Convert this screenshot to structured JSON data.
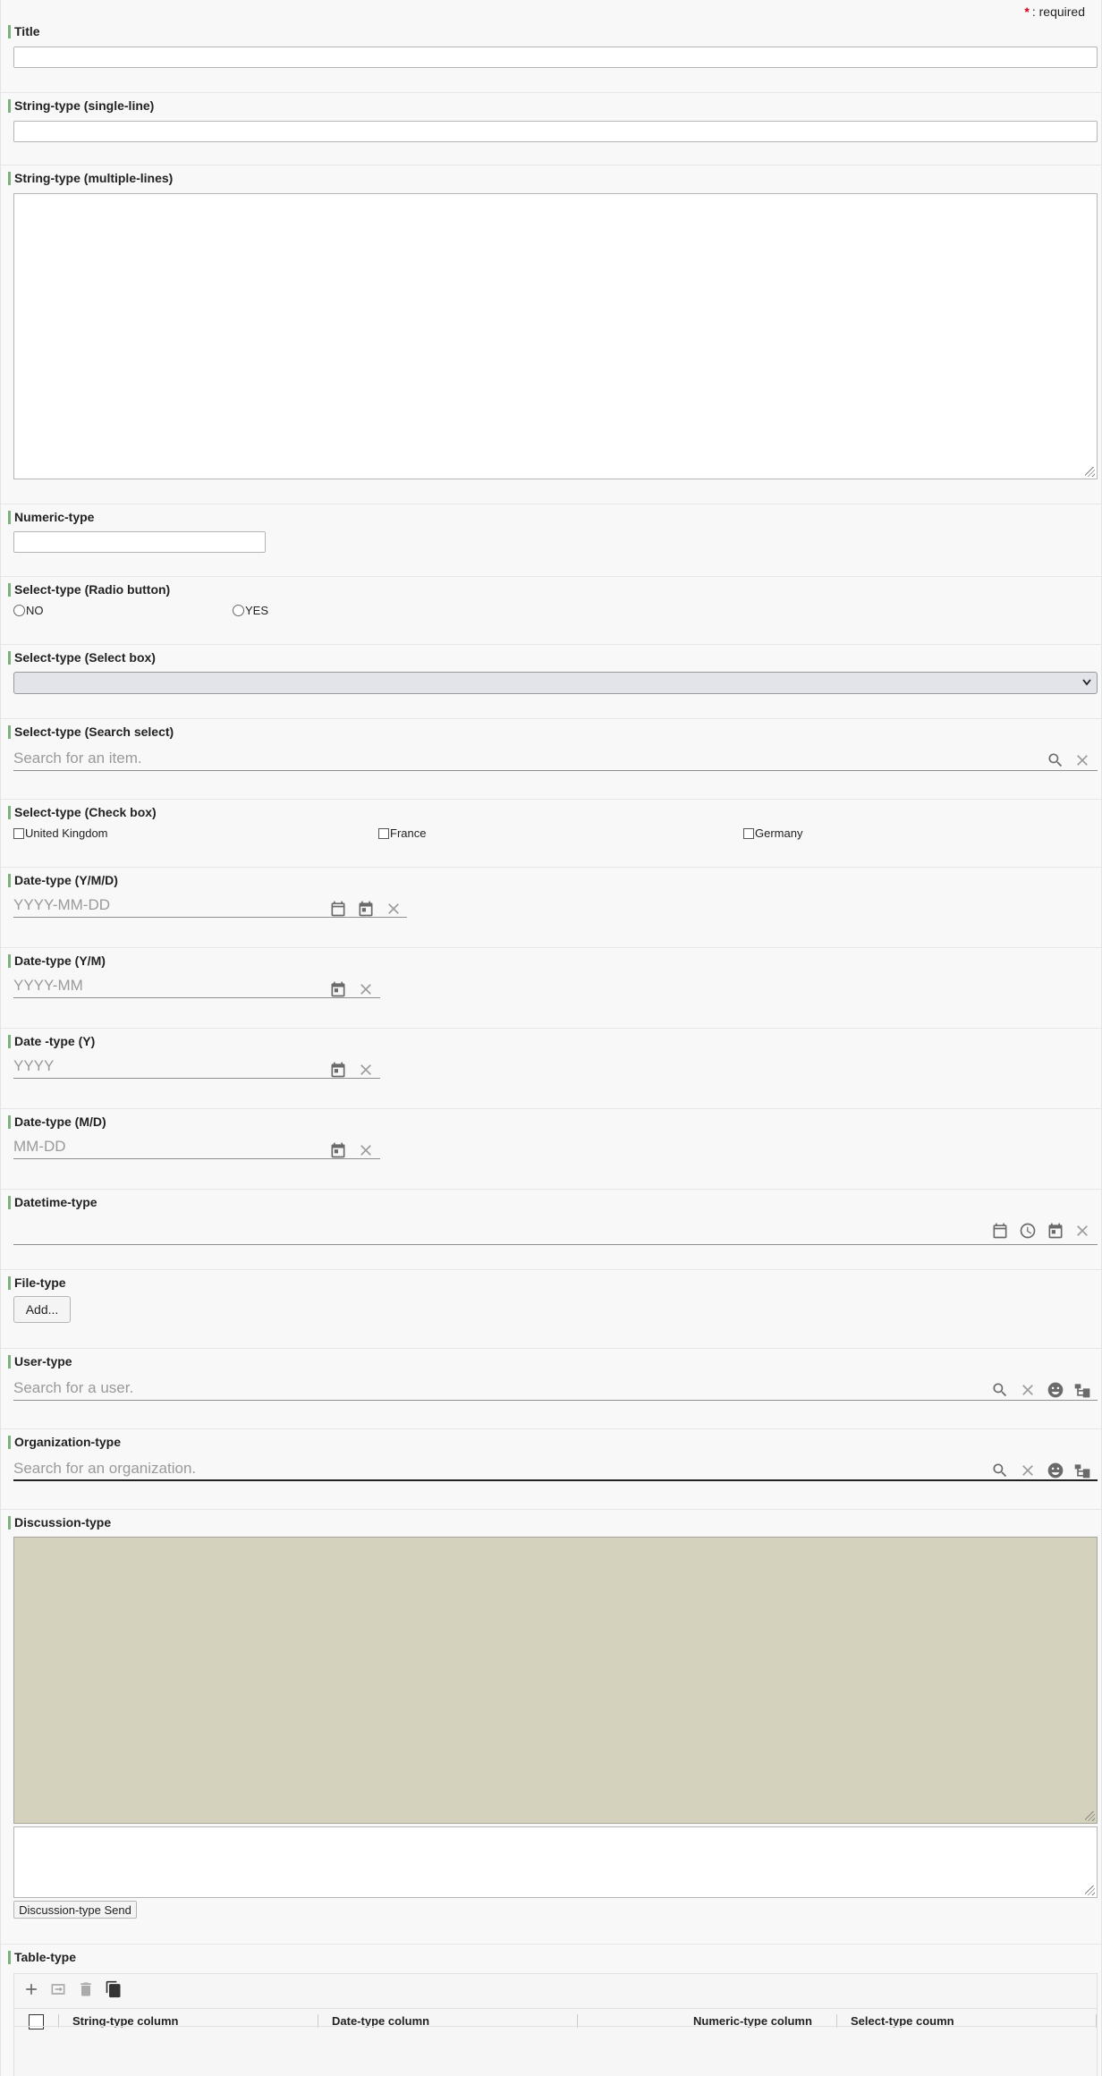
{
  "required_note": {
    "star": "*",
    "text": ": required"
  },
  "fields": {
    "title": {
      "label": "Title"
    },
    "string_single": {
      "label": "String-type (single-line)"
    },
    "string_multi": {
      "label": "String-type (multiple-lines)"
    },
    "numeric": {
      "label": "Numeric-type"
    },
    "radio": {
      "label": "Select-type (Radio button)",
      "options": [
        "NO",
        "YES"
      ]
    },
    "selectbox": {
      "label": "Select-type (Select box)"
    },
    "search_select": {
      "label": "Select-type (Search select)",
      "placeholder": "Search for an item."
    },
    "checkbox": {
      "label": "Select-type (Check box)",
      "options": [
        "United Kingdom",
        "France",
        "Germany"
      ]
    },
    "date_ymd": {
      "label": "Date-type (Y/M/D)",
      "placeholder": "YYYY-MM-DD"
    },
    "date_ym": {
      "label": "Date-type (Y/M)",
      "placeholder": "YYYY-MM"
    },
    "date_y": {
      "label": "Date -type (Y)",
      "placeholder": "YYYY"
    },
    "date_md": {
      "label": "Date-type (M/D)",
      "placeholder": "MM-DD"
    },
    "datetime": {
      "label": "Datetime-type"
    },
    "file": {
      "label": "File-type",
      "button": "Add..."
    },
    "user": {
      "label": "User-type",
      "placeholder": "Search for a user."
    },
    "org": {
      "label": "Organization-type",
      "placeholder": "Search for an organization."
    },
    "discussion": {
      "label": "Discussion-type",
      "send": "Discussion-type Send"
    },
    "table": {
      "label": "Table-type",
      "columns": [
        "String-type column",
        "Date-type column",
        "Numeric-type column",
        "Select-type coumn"
      ]
    }
  },
  "icons": {
    "search": "search-icon",
    "clear": "close-icon",
    "calendar": "calendar-icon",
    "calendar_today": "calendar-today-icon",
    "clock": "clock-icon",
    "face": "face-icon",
    "tree": "org-tree-icon",
    "add": "plus-icon",
    "insert": "insert-row-icon",
    "delete": "trash-icon",
    "copy": "copy-icon"
  },
  "colors": {
    "accent": "#7cb07c",
    "required": "#d0021b",
    "discussion_bg": "#d4d2bd"
  }
}
